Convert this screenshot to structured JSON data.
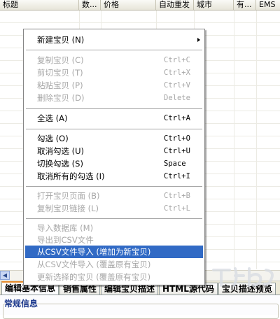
{
  "header": {
    "columns": [
      {
        "key": "title",
        "label": "标题"
      },
      {
        "key": "qty",
        "label": "数..."
      },
      {
        "key": "price",
        "label": "价格"
      },
      {
        "key": "auto",
        "label": "自动重发"
      },
      {
        "key": "city",
        "label": "城市"
      },
      {
        "key": "has",
        "label": "有..."
      },
      {
        "key": "ems",
        "label": "EMS"
      }
    ]
  },
  "context_menu": {
    "items": [
      {
        "label": "新建宝贝 (N)",
        "shortcut": "",
        "disabled": false
      },
      {
        "label": "复制宝贝 (C)",
        "shortcut": "Ctrl+C",
        "disabled": true
      },
      {
        "label": "剪切宝贝 (T)",
        "shortcut": "Ctrl+X",
        "disabled": true
      },
      {
        "label": "粘贴宝贝 (P)",
        "shortcut": "Ctrl+V",
        "disabled": true
      },
      {
        "label": "删除宝贝 (D)",
        "shortcut": "Delete",
        "disabled": true
      },
      {
        "label": "全选 (A)",
        "shortcut": "Ctrl+A",
        "disabled": false
      },
      {
        "label": "勾选 (O)",
        "shortcut": "Ctrl+O",
        "disabled": false
      },
      {
        "label": "取消勾选 (U)",
        "shortcut": "Ctrl+U",
        "disabled": false
      },
      {
        "label": "切换勾选 (S)",
        "shortcut": "Space",
        "disabled": false
      },
      {
        "label": "取消所有的勾选 (I)",
        "shortcut": "Ctrl+I",
        "disabled": false
      },
      {
        "label": "打开宝贝页面 (B)",
        "shortcut": "Ctrl+B",
        "disabled": true
      },
      {
        "label": "复制宝贝链接 (L)",
        "shortcut": "Ctrl+L",
        "disabled": true
      },
      {
        "label": "导入数据库 (M)",
        "shortcut": "",
        "disabled": true
      },
      {
        "label": "导出到CSV文件",
        "shortcut": "",
        "disabled": true
      },
      {
        "label": "从CSV文件导入 (增加为新宝贝)",
        "shortcut": "",
        "disabled": false,
        "highlighted": true
      },
      {
        "label": "从CSV文件导入 (覆盖原有宝贝)",
        "shortcut": "",
        "disabled": true
      },
      {
        "label": "更新选择的宝贝 (覆盖原有宝贝)",
        "shortcut": "",
        "disabled": true
      }
    ]
  },
  "tabs": [
    {
      "label": "编辑基本信息",
      "active": true
    },
    {
      "label": "销售属性",
      "active": false
    },
    {
      "label": "编辑宝贝描述",
      "active": false
    },
    {
      "label": "HTML源代码",
      "active": false
    },
    {
      "label": "宝贝描述预览",
      "active": false
    }
  ],
  "panel": {
    "section_title": "常规信息"
  },
  "colors": {
    "menu_highlight": "#316ac5",
    "disabled_text": "#a7a7a7",
    "active_tab_accent": "#e68b2c"
  },
  "icons": {
    "submenu": "submenu-arrow-icon",
    "scroll_left": "scroll-left-icon"
  }
}
